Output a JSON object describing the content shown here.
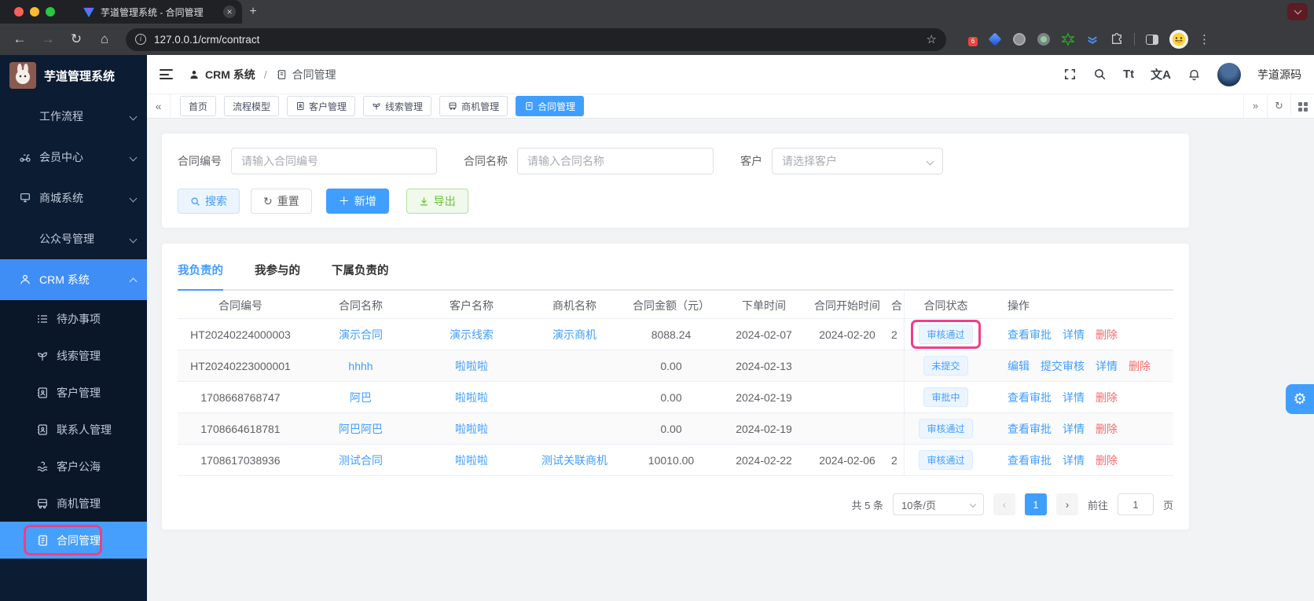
{
  "browser": {
    "tab_title": "芋道管理系统 - 合同管理",
    "url": "127.0.0.1/crm/contract",
    "extension_badge_count": "6"
  },
  "sidebar": {
    "app_title": "芋道管理系统",
    "menu": [
      {
        "label": "工作流程"
      },
      {
        "label": "会员中心"
      },
      {
        "label": "商城系统"
      },
      {
        "label": "公众号管理"
      },
      {
        "label": "CRM 系统"
      }
    ],
    "submenu": [
      {
        "label": "待办事项"
      },
      {
        "label": "线索管理"
      },
      {
        "label": "客户管理"
      },
      {
        "label": "联系人管理"
      },
      {
        "label": "客户公海"
      },
      {
        "label": "商机管理"
      },
      {
        "label": "合同管理"
      }
    ]
  },
  "header": {
    "breadcrumb_root": "CRM 系统",
    "breadcrumb_sep": "/",
    "breadcrumb_current": "合同管理",
    "font_size_icon_label": "Tt",
    "translate_icon_label": "文A",
    "username": "芋道源码"
  },
  "tagbar": {
    "tabs": [
      {
        "label": "首页"
      },
      {
        "label": "流程模型"
      },
      {
        "label": "客户管理"
      },
      {
        "label": "线索管理"
      },
      {
        "label": "商机管理"
      },
      {
        "label": "合同管理"
      }
    ]
  },
  "filter": {
    "contract_no_label": "合同编号",
    "contract_no_placeholder": "请输入合同编号",
    "contract_name_label": "合同名称",
    "contract_name_placeholder": "请输入合同名称",
    "customer_label": "客户",
    "customer_placeholder": "请选择客户",
    "search_label": "搜索",
    "reset_label": "重置",
    "add_label": "新增",
    "export_label": "导出"
  },
  "panel": {
    "tabs": [
      {
        "label": "我负责的"
      },
      {
        "label": "我参与的"
      },
      {
        "label": "下属负责的"
      }
    ]
  },
  "table": {
    "columns": [
      "合同编号",
      "合同名称",
      "客户名称",
      "商机名称",
      "合同金额（元）",
      "下单时间",
      "合同开始时间",
      "合",
      "合同状态",
      "操作"
    ],
    "rows": [
      {
        "contract_no": "HT20240224000003",
        "contract_name": "演示合同",
        "customer_name": "演示线索",
        "business_name": "演示商机",
        "amount": "8088.24",
        "order_time": "2024-02-07",
        "start_time": "2024-02-20",
        "end_time_cut": "2",
        "status": "审核通过",
        "actions": [
          "查看审批",
          "详情",
          "删除"
        ]
      },
      {
        "contract_no": "HT20240223000001",
        "contract_name": "hhhh",
        "customer_name": "啦啦啦",
        "business_name": "",
        "amount": "0.00",
        "order_time": "2024-02-13",
        "start_time": "",
        "end_time_cut": "",
        "status": "未提交",
        "actions": [
          "编辑",
          "提交审核",
          "详情",
          "删除"
        ]
      },
      {
        "contract_no": "1708668768747",
        "contract_name": "阿巴",
        "customer_name": "啦啦啦",
        "business_name": "",
        "amount": "0.00",
        "order_time": "2024-02-19",
        "start_time": "",
        "end_time_cut": "",
        "status": "审批中",
        "actions": [
          "查看审批",
          "详情",
          "删除"
        ]
      },
      {
        "contract_no": "1708664618781",
        "contract_name": "阿巴阿巴",
        "customer_name": "啦啦啦",
        "business_name": "",
        "amount": "0.00",
        "order_time": "2024-02-19",
        "start_time": "",
        "end_time_cut": "",
        "status": "审核通过",
        "actions": [
          "查看审批",
          "详情",
          "删除"
        ]
      },
      {
        "contract_no": "1708617038936",
        "contract_name": "测试合同",
        "customer_name": "啦啦啦",
        "business_name": "测试关联商机",
        "amount": "10010.00",
        "order_time": "2024-02-22",
        "start_time": "2024-02-06",
        "end_time_cut": "2",
        "status": "审核通过",
        "actions": [
          "查看审批",
          "详情",
          "删除"
        ]
      }
    ]
  },
  "pagination": {
    "total": "共 5 条",
    "page_size": "10条/页",
    "page": "1",
    "goto_label": "前往",
    "goto_value": "1",
    "unit_label": "页"
  },
  "colors": {
    "primary": "#409eff",
    "danger": "#f56c6c",
    "success": "#67c23a",
    "annotation": "#ee3f87",
    "sidebar_bg": "#0c1c33"
  }
}
